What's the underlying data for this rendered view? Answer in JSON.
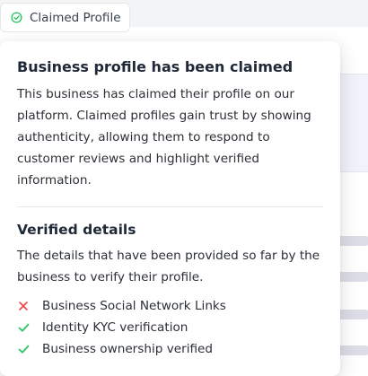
{
  "chip": {
    "label": "Claimed Profile",
    "icon": "check-circle-icon",
    "icon_color": "#22c55e"
  },
  "popover": {
    "title": "Business profile has been claimed",
    "body": "This business has claimed their profile on our platform. Claimed profiles gain trust by showing authenticity, allowing them to respond to customer reviews and highlight verified information.",
    "verified": {
      "title": "Verified details",
      "description": "The details that have been provided so far by the business to verify their profile.",
      "items": [
        {
          "label": "Business Social Network Links",
          "status": "not-verified",
          "icon": "x-icon",
          "color": "#ef4444"
        },
        {
          "label": "Identity KYC verification",
          "status": "verified",
          "icon": "check-icon",
          "color": "#22c55e"
        },
        {
          "label": "Business ownership verified",
          "status": "verified",
          "icon": "check-icon",
          "color": "#22c55e"
        }
      ]
    }
  },
  "colors": {
    "accent_green": "#22c55e",
    "accent_red": "#ef4444"
  }
}
